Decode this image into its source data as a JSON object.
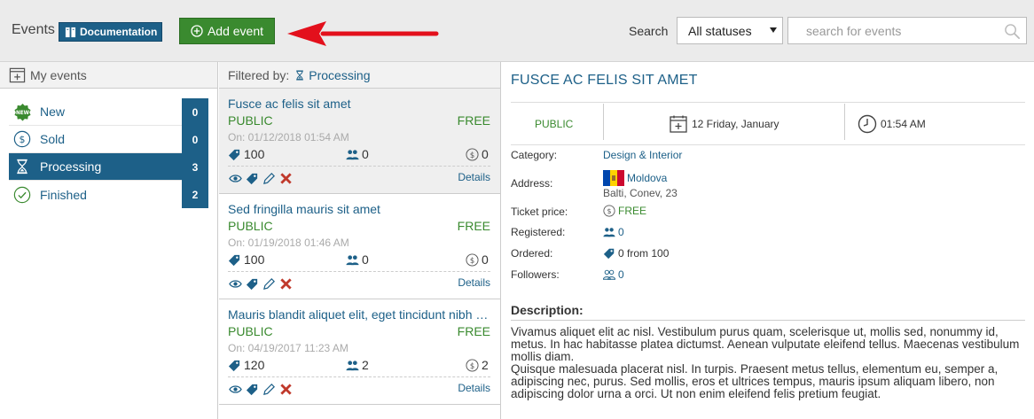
{
  "header": {
    "title": "Events",
    "documentation_label": "Documentation",
    "add_event_label": "Add event",
    "search_label": "Search",
    "status_filter": "All statuses",
    "search_placeholder": "search for events"
  },
  "sidebar": {
    "heading": "My events",
    "items": [
      {
        "label": "New",
        "count": "0",
        "icon": "new-badge-icon"
      },
      {
        "label": "Sold",
        "count": "0",
        "icon": "dollar-circle-icon"
      },
      {
        "label": "Processing",
        "count": "3",
        "icon": "hourglass-icon",
        "active": true
      },
      {
        "label": "Finished",
        "count": "2",
        "icon": "check-circle-icon"
      }
    ]
  },
  "event_list": {
    "filter_label": "Filtered by:",
    "filter_value": "Processing",
    "details_label": "Details",
    "events": [
      {
        "title": "Fusce ac felis sit amet",
        "visibility": "PUBLIC",
        "price": "FREE",
        "date": "On: 01/12/2018 01:54 AM",
        "tickets": "100",
        "registered": "0",
        "ordered": "0"
      },
      {
        "title": "Sed fringilla mauris sit amet",
        "visibility": "PUBLIC",
        "price": "FREE",
        "date": "On: 01/19/2018 01:46 AM",
        "tickets": "100",
        "registered": "0",
        "ordered": "0"
      },
      {
        "title": "Mauris blandit aliquet elit, eget tincidunt nibh …",
        "visibility": "PUBLIC",
        "price": "FREE",
        "date": "On: 04/19/2017 11:23 AM",
        "tickets": "120",
        "registered": "2",
        "ordered": "2"
      }
    ]
  },
  "detail": {
    "title": "FUSCE AC FELIS SIT AMET",
    "visibility": "PUBLIC",
    "date": "12 Friday, January",
    "time": "01:54 AM",
    "category_label": "Category:",
    "category": "Design & Interior",
    "address_label": "Address:",
    "country": "Moldova",
    "address": "Balti, Conev, 23",
    "ticket_price_label": "Ticket price:",
    "ticket_price": "FREE",
    "registered_label": "Registered:",
    "registered": "0",
    "ordered_label": "Ordered:",
    "ordered": "0 from 100",
    "followers_label": "Followers:",
    "followers": "0",
    "description_heading": "Description:",
    "description": [
      "Vivamus aliquet elit ac nisl. Vestibulum purus quam, scelerisque ut, mollis sed, nonummy id, metus. In hac habitasse platea dictumst. Aenean vulputate eleifend tellus. Maecenas vestibulum mollis diam.",
      "Quisque malesuada placerat nisl. In turpis. Praesent metus tellus, elementum eu, semper a, adipiscing nec, purus. Sed mollis, eros et ultrices tempus, mauris ipsum aliquam libero, non adipiscing dolor urna a orci. Ut non enim eleifend felis pretium feugiat."
    ]
  },
  "colors": {
    "brand_blue": "#1d6088",
    "green": "#3a8a2f",
    "delete_red": "#c0392b",
    "arrow_red": "#e3101c"
  }
}
